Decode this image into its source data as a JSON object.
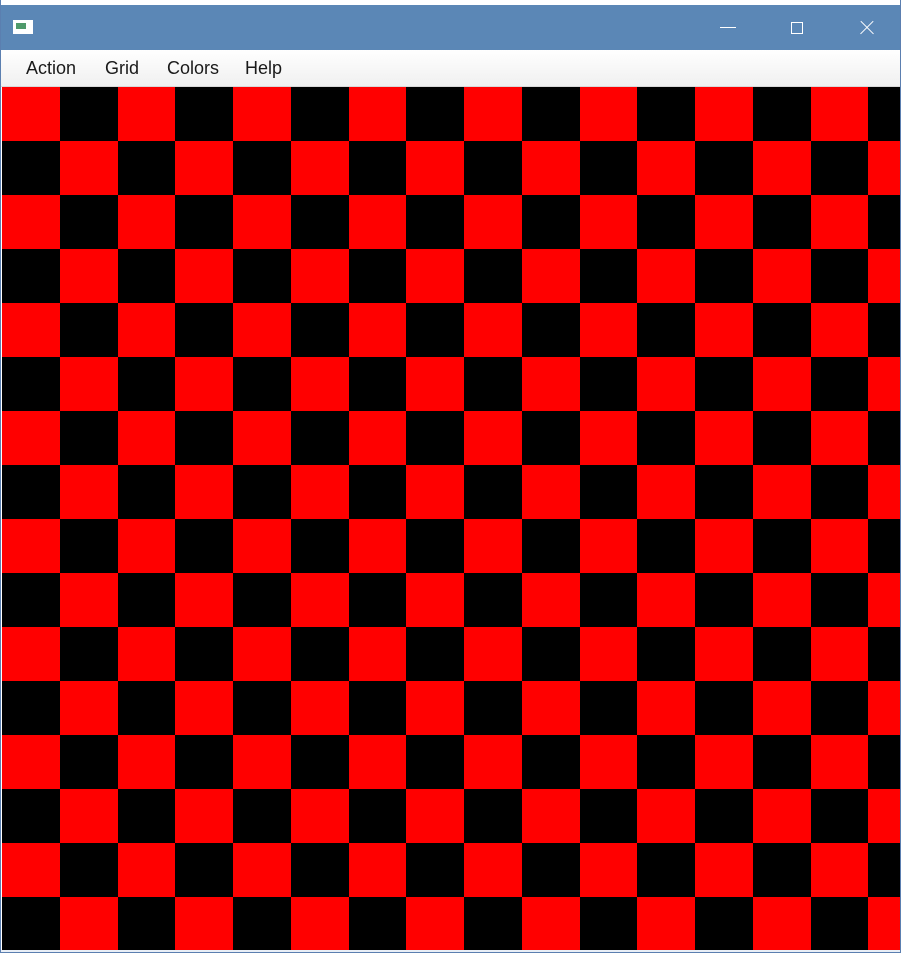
{
  "window": {
    "app_icon": "window-app-icon",
    "controls": {
      "minimize_icon": "minimize-icon",
      "maximize_icon": "maximize-icon",
      "close_icon": "close-icon"
    }
  },
  "menubar": {
    "items": [
      {
        "label": "Action"
      },
      {
        "label": "Grid"
      },
      {
        "label": "Colors"
      },
      {
        "label": "Help"
      }
    ]
  },
  "board": {
    "rows": 16,
    "cols": 16,
    "colors": {
      "primary": "#ff0000",
      "secondary": "#000000"
    },
    "top_left_color": "primary"
  },
  "theme": {
    "titlebar_color": "#5b87b6"
  }
}
